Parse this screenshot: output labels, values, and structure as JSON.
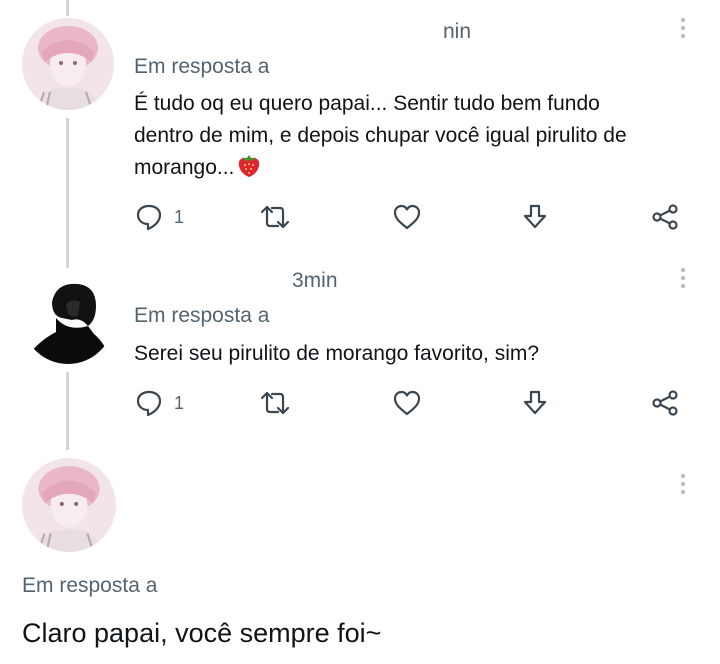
{
  "colors": {
    "text": "#0f1419",
    "secondary": "#536471",
    "line": "#cfd9de",
    "strawberry": "#e0242f"
  },
  "tweets": [
    {
      "time": "nin",
      "reply_prefix": "Em resposta a",
      "text_lines": [
        "É tudo oq eu quero papai... Sentir tudo bem fundo",
        "dentro de mim, e depois chupar você igual pirulito de",
        "morango..."
      ],
      "emoji": "strawberry",
      "reply_count": "1",
      "avatar": "pink-avatar"
    },
    {
      "time": "3min",
      "reply_prefix": "Em resposta a",
      "text_lines": [
        "Serei seu pirulito de morango favorito, sim?"
      ],
      "reply_count": "1",
      "avatar": "dark-avatar"
    },
    {
      "reply_prefix": "Em resposta a",
      "text": "Claro papai, você sempre foi~",
      "avatar": "pink-avatar"
    }
  ],
  "icons": [
    "reply-icon",
    "retweet-icon",
    "like-icon",
    "download-icon",
    "share-icon",
    "more-icon"
  ]
}
